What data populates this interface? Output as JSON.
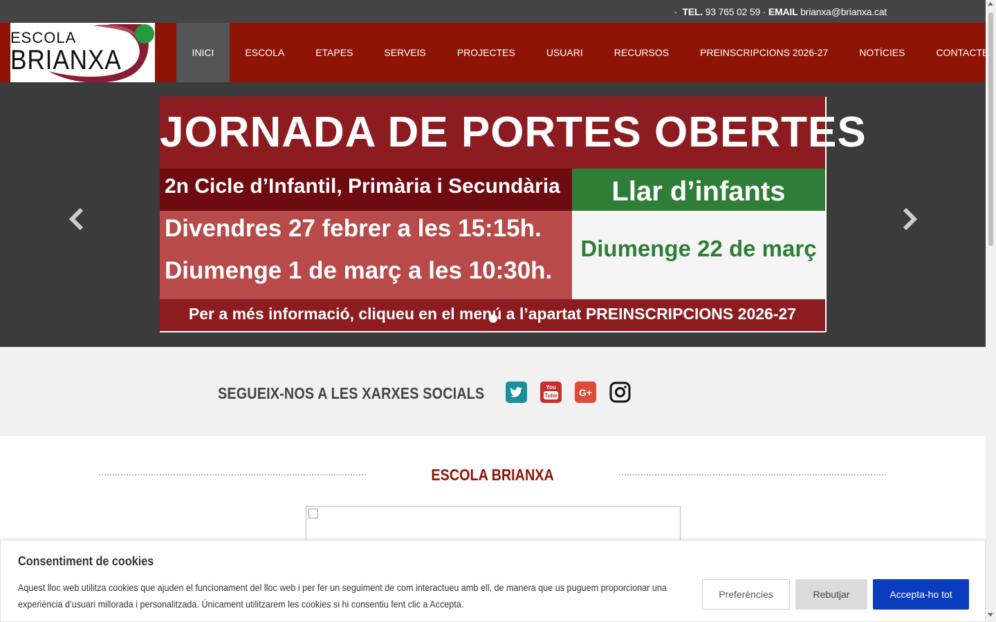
{
  "topbar": {
    "tel_label": "TEL.",
    "tel_value": "93 765 02 59",
    "email_label": "EMAIL",
    "email_value": "brianxa@brianxa.cat"
  },
  "logo": {
    "line1": "ESCOLA",
    "line2": "BRIANXA"
  },
  "nav": {
    "items": [
      {
        "label": "INICI",
        "active": true
      },
      {
        "label": "ESCOLA"
      },
      {
        "label": "ETAPES"
      },
      {
        "label": "SERVEIS"
      },
      {
        "label": "PROJECTES"
      },
      {
        "label": "USUARI"
      },
      {
        "label": "RECURSOS"
      },
      {
        "label": "PREINSCRIPCIONS 2026-27"
      },
      {
        "label": "NOTÍCIES"
      },
      {
        "label": "CONTACTE"
      }
    ]
  },
  "banner": {
    "title": "JORNADA DE PORTES OBERTES",
    "subtitle": "2n Cicle d’Infantil, Primària i Secundària",
    "llar": "Llar d’infants",
    "date1": "Divendres 27 febrer a les 15:15h.",
    "date2": "Diumenge 1 de març a les 10:30h.",
    "llar_date": "Diumenge 22 de març",
    "info": "Per a més informació, cliqueu en el menú a l’apartat PREINSCRIPCIONS 2026-27"
  },
  "social": {
    "title": "SEGUEIX-NOS A LES XARXES SOCIALS",
    "youtube_text": "You Tube",
    "googleplus_text": "G+"
  },
  "section": {
    "title": "ESCOLA BRIANXA"
  },
  "cookie": {
    "title": "Consentiment de cookies",
    "text": "Aquest lloc web utilitza cookies que ajuden el funcionament del lloc web i per fer un seguiment de com interactueu amb ell, de manera que us puguem proporcionar una experiència d’usuari millorada i personalitzada. Únicament utilitzarem les cookies si hi consentiu fent clic a Accepta.",
    "preferences": "Preferències",
    "reject": "Rebutjar",
    "accept": "Accepta-ho tot"
  },
  "colors": {
    "brand_red": "#8e1406",
    "banner_red": "#8d1c20",
    "banner_green": "#2f7e37",
    "accept_blue": "#0a3dbd"
  }
}
